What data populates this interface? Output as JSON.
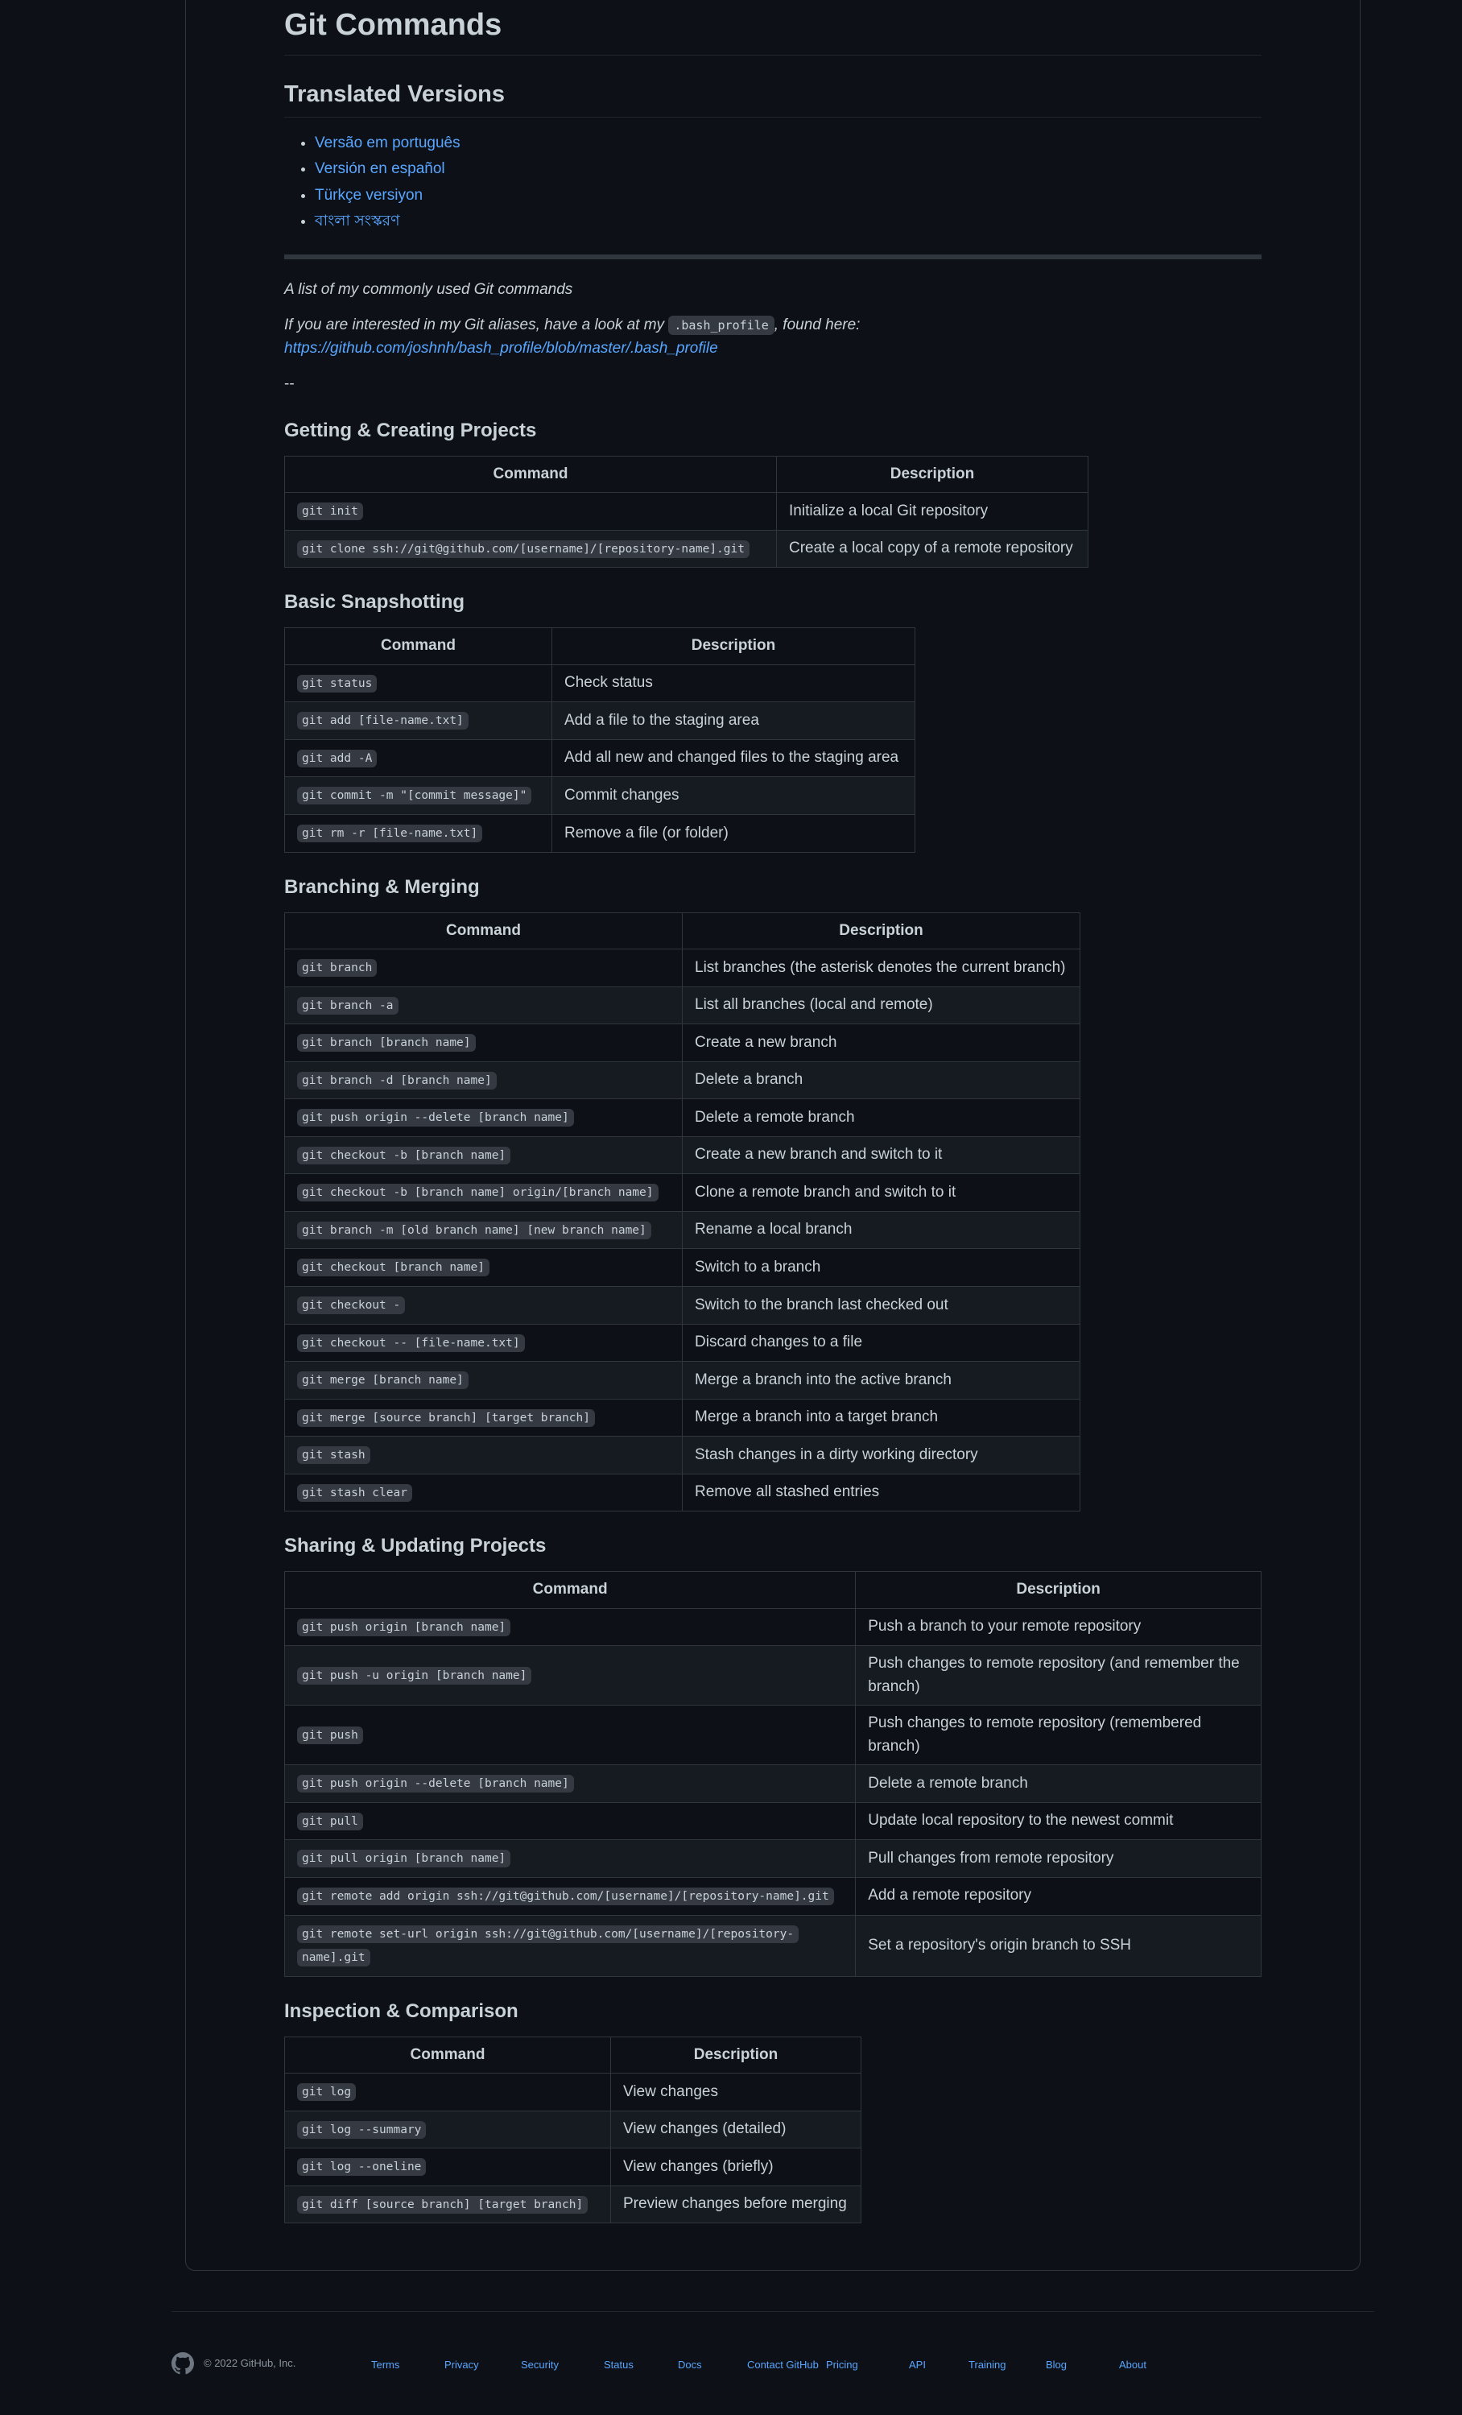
{
  "title": "Git Commands",
  "translated": {
    "heading": "Translated Versions",
    "links": [
      "Versão em português",
      "Versión en español",
      "Türkçe versiyon",
      "বাংলা সংস্করণ"
    ]
  },
  "intro": {
    "line1": "A list of my commonly used Git commands",
    "line2_prefix": "If you are interested in my Git aliases, have a look at my ",
    "line2_code": ".bash_profile",
    "line2_suffix": ", found here:",
    "line2_link": "https://github.com/joshnh/bash_profile/blob/master/.bash_profile",
    "separator": "--"
  },
  "sections": [
    {
      "title": "Getting & Creating Projects",
      "headers": [
        "Command",
        "Description"
      ],
      "rows": [
        [
          "git init",
          "Initialize a local Git repository"
        ],
        [
          "git clone ssh://git@github.com/[username]/[repository-name].git",
          "Create a local copy of a remote repository"
        ]
      ]
    },
    {
      "title": "Basic Snapshotting",
      "headers": [
        "Command",
        "Description"
      ],
      "rows": [
        [
          "git status",
          "Check status"
        ],
        [
          "git add [file-name.txt]",
          "Add a file to the staging area"
        ],
        [
          "git add -A",
          "Add all new and changed files to the staging area"
        ],
        [
          "git commit -m \"[commit message]\"",
          "Commit changes"
        ],
        [
          "git rm -r [file-name.txt]",
          "Remove a file (or folder)"
        ]
      ]
    },
    {
      "title": "Branching & Merging",
      "headers": [
        "Command",
        "Description"
      ],
      "rows": [
        [
          "git branch",
          "List branches (the asterisk denotes the current branch)"
        ],
        [
          "git branch -a",
          "List all branches (local and remote)"
        ],
        [
          "git branch [branch name]",
          "Create a new branch"
        ],
        [
          "git branch -d [branch name]",
          "Delete a branch"
        ],
        [
          "git push origin --delete [branch name]",
          "Delete a remote branch"
        ],
        [
          "git checkout -b [branch name]",
          "Create a new branch and switch to it"
        ],
        [
          "git checkout -b [branch name] origin/[branch name]",
          "Clone a remote branch and switch to it"
        ],
        [
          "git branch -m [old branch name] [new branch name]",
          "Rename a local branch"
        ],
        [
          "git checkout [branch name]",
          "Switch to a branch"
        ],
        [
          "git checkout -",
          "Switch to the branch last checked out"
        ],
        [
          "git checkout -- [file-name.txt]",
          "Discard changes to a file"
        ],
        [
          "git merge [branch name]",
          "Merge a branch into the active branch"
        ],
        [
          "git merge [source branch] [target branch]",
          "Merge a branch into a target branch"
        ],
        [
          "git stash",
          "Stash changes in a dirty working directory"
        ],
        [
          "git stash clear",
          "Remove all stashed entries"
        ]
      ]
    },
    {
      "title": "Sharing & Updating Projects",
      "headers": [
        "Command",
        "Description"
      ],
      "rows": [
        [
          "git push origin [branch name]",
          "Push a branch to your remote repository"
        ],
        [
          "git push -u origin [branch name]",
          "Push changes to remote repository (and remember the branch)"
        ],
        [
          "git push",
          "Push changes to remote repository (remembered branch)"
        ],
        [
          "git push origin --delete [branch name]",
          "Delete a remote branch"
        ],
        [
          "git pull",
          "Update local repository to the newest commit"
        ],
        [
          "git pull origin [branch name]",
          "Pull changes from remote repository"
        ],
        [
          "git remote add origin ssh://git@github.com/[username]/[repository-name].git",
          "Add a remote repository"
        ],
        [
          "git remote set-url origin ssh://git@github.com/[username]/[repository-name].git",
          "Set a repository's origin branch to SSH"
        ]
      ]
    },
    {
      "title": "Inspection & Comparison",
      "headers": [
        "Command",
        "Description"
      ],
      "rows": [
        [
          "git log",
          "View changes"
        ],
        [
          "git log --summary",
          "View changes (detailed)"
        ],
        [
          "git log --oneline",
          "View changes (briefly)"
        ],
        [
          "git diff [source branch] [target branch]",
          "Preview changes before merging"
        ]
      ]
    }
  ],
  "footer": {
    "copyright": "© 2022 GitHub, Inc.",
    "links": [
      "Terms",
      "Privacy",
      "Security",
      "Status",
      "Docs",
      "Contact GitHub",
      "Pricing",
      "API",
      "Training",
      "Blog",
      "About"
    ],
    "icon": "github-logo-icon"
  },
  "colors": {
    "background": "#0d1117",
    "text": "#c9d1d9",
    "link": "#58a6ff",
    "border": "#30363d"
  }
}
